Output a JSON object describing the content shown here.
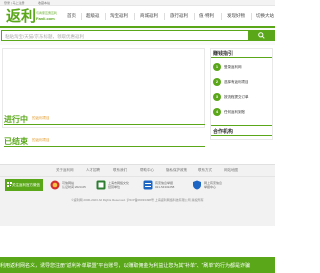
{
  "topbar": {
    "login": "登录 | 马上注册",
    "fav": "收藏本站"
  },
  "logo": {
    "mark": "返利",
    "sub": "与商家互惠互利",
    "url": "Fanli.com"
  },
  "nav": [
    "首页",
    "超级返",
    "淘宝返利",
    "商城返利",
    "旅行返利",
    "值·特利",
    "发现好物",
    "切换大站"
  ],
  "search": {
    "placeholder": "粘贴淘宝/天猫/京东标题，领取优惠返利"
  },
  "sections": {
    "ongoing": {
      "title": "进行中",
      "tag": "的返利项目"
    },
    "ended": {
      "title": "已结束",
      "tag": "的返利项目"
    }
  },
  "sidebar": {
    "title": "赚钱指引",
    "steps": [
      {
        "num": "1",
        "text": "登录返利网"
      },
      {
        "num": "2",
        "text": "选择有返利项目"
      },
      {
        "num": "3",
        "text": "按流程提交订单"
      },
      {
        "num": "4",
        "text": "任何返利到账"
      }
    ],
    "partners_title": "合作机构"
  },
  "footer": {
    "links": [
      "关于返利网",
      "人才招聘",
      "联系我们",
      "帮助中心",
      "隐私保护政策",
      "联系方式",
      "网站地图"
    ],
    "follow": "关注返利官方微信",
    "badges": [
      {
        "title": "可信网站",
        "sub": "认证时间:2023-05"
      },
      {
        "title": "上海市网络文化",
        "sub": "经营单位"
      },
      {
        "title": "有害信息举报",
        "sub": "021-54332258"
      },
      {
        "title": "网上有害信息",
        "sub": "举报中心"
      }
    ],
    "copyright": "©返利网 2006-2023 All Rights Reserved. 沪ICP备06033498号 上海返利网络科技有限公司 版权所有"
  },
  "notice": "利用返利网名义，诱导您注册“返利补单联盟”平台账号，以赚取佣金为利益让您为其“补单”、“刷单”的行为都是诈骗"
}
